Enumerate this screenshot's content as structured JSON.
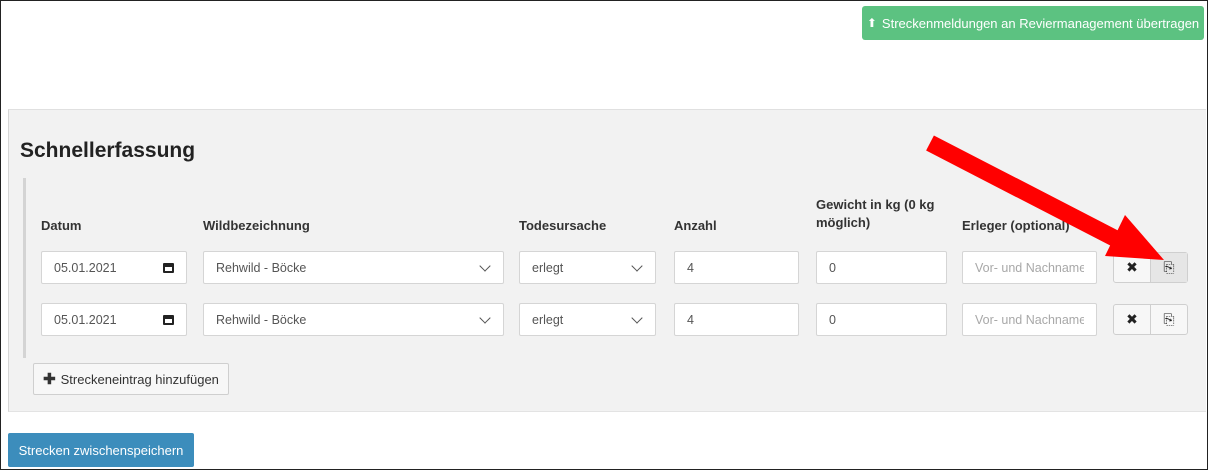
{
  "toolbar": {
    "upload_label": "Streckenmeldungen an Reviermanagement übertragen",
    "upload_icon": "upload-icon"
  },
  "panel": {
    "title": "Schnellerfassung"
  },
  "table": {
    "headers": {
      "datum": "Datum",
      "wild": "Wildbezeichnung",
      "todesursache": "Todesursache",
      "anzahl": "Anzahl",
      "gewicht_line1": "Gewicht in kg (0 kg",
      "gewicht_line2": "möglich)",
      "erleger": "Erleger (optional)"
    },
    "rows": [
      {
        "datum": "05.01.2021",
        "wild": "Rehwild - Böcke",
        "todesursache": "erlegt",
        "anzahl": "4",
        "gewicht": "0",
        "erleger_placeholder": "Vor- und Nachname"
      },
      {
        "datum": "05.01.2021",
        "wild": "Rehwild - Böcke",
        "todesursache": "erlegt",
        "anzahl": "4",
        "gewicht": "0",
        "erleger_placeholder": "Vor- und Nachname"
      }
    ]
  },
  "actions": {
    "add_label": "Streckeneintrag hinzufügen",
    "save_label": "Strecken zwischenspeichern"
  },
  "colors": {
    "upload_button": "#5cc281",
    "save_button": "#3c8dbc",
    "annotation_arrow": "#ff0000"
  }
}
